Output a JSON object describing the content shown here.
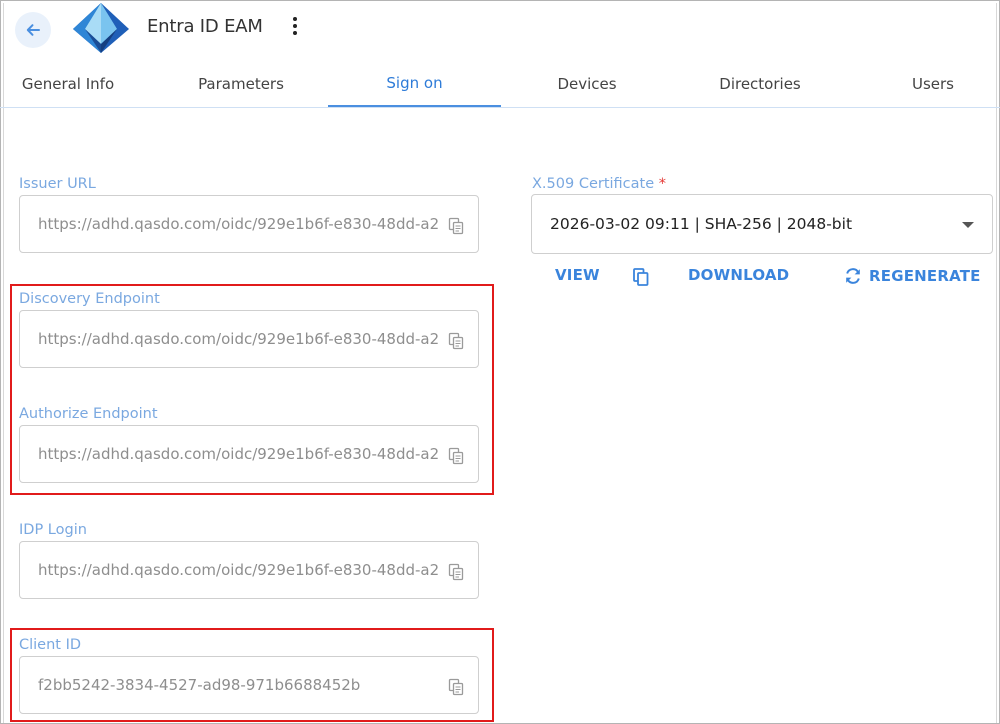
{
  "header": {
    "back_icon": "arrow-left-icon",
    "logo_icon": "entra-id-logo",
    "title": "Entra ID EAM",
    "menu_icon": "more-vertical-icon"
  },
  "tabs": [
    {
      "label": "General Info",
      "active": false
    },
    {
      "label": "Parameters",
      "active": false
    },
    {
      "label": "Sign on",
      "active": true
    },
    {
      "label": "Devices",
      "active": false
    },
    {
      "label": "Directories",
      "active": false
    },
    {
      "label": "Users",
      "active": false
    }
  ],
  "fields": {
    "issuer_url": {
      "label": "Issuer URL",
      "value": "https://adhd.qasdo.com/oidc/929e1b6f-e830-48dd-a2"
    },
    "discovery_endpoint": {
      "label": "Discovery Endpoint",
      "value": "https://adhd.qasdo.com/oidc/929e1b6f-e830-48dd-a2"
    },
    "authorize_endpoint": {
      "label": "Authorize Endpoint",
      "value": "https://adhd.qasdo.com/oidc/929e1b6f-e830-48dd-a2"
    },
    "idp_login": {
      "label": "IDP Login",
      "value": "https://adhd.qasdo.com/oidc/929e1b6f-e830-48dd-a2"
    },
    "client_id": {
      "label": "Client ID",
      "value": "f2bb5242-3834-4527-ad98-971b6688452b"
    }
  },
  "certificate": {
    "label": "X.509 Certificate",
    "required_mark": "*",
    "selected": "2026-03-02 09:11 | SHA-256 | 2048-bit",
    "actions": {
      "view": "VIEW",
      "download": "DOWNLOAD",
      "regenerate": "REGENERATE"
    }
  },
  "colors": {
    "accent": "#2d7bd8",
    "label": "#7aa8e0",
    "highlight": "#e11b1b",
    "required": "#e53935"
  }
}
